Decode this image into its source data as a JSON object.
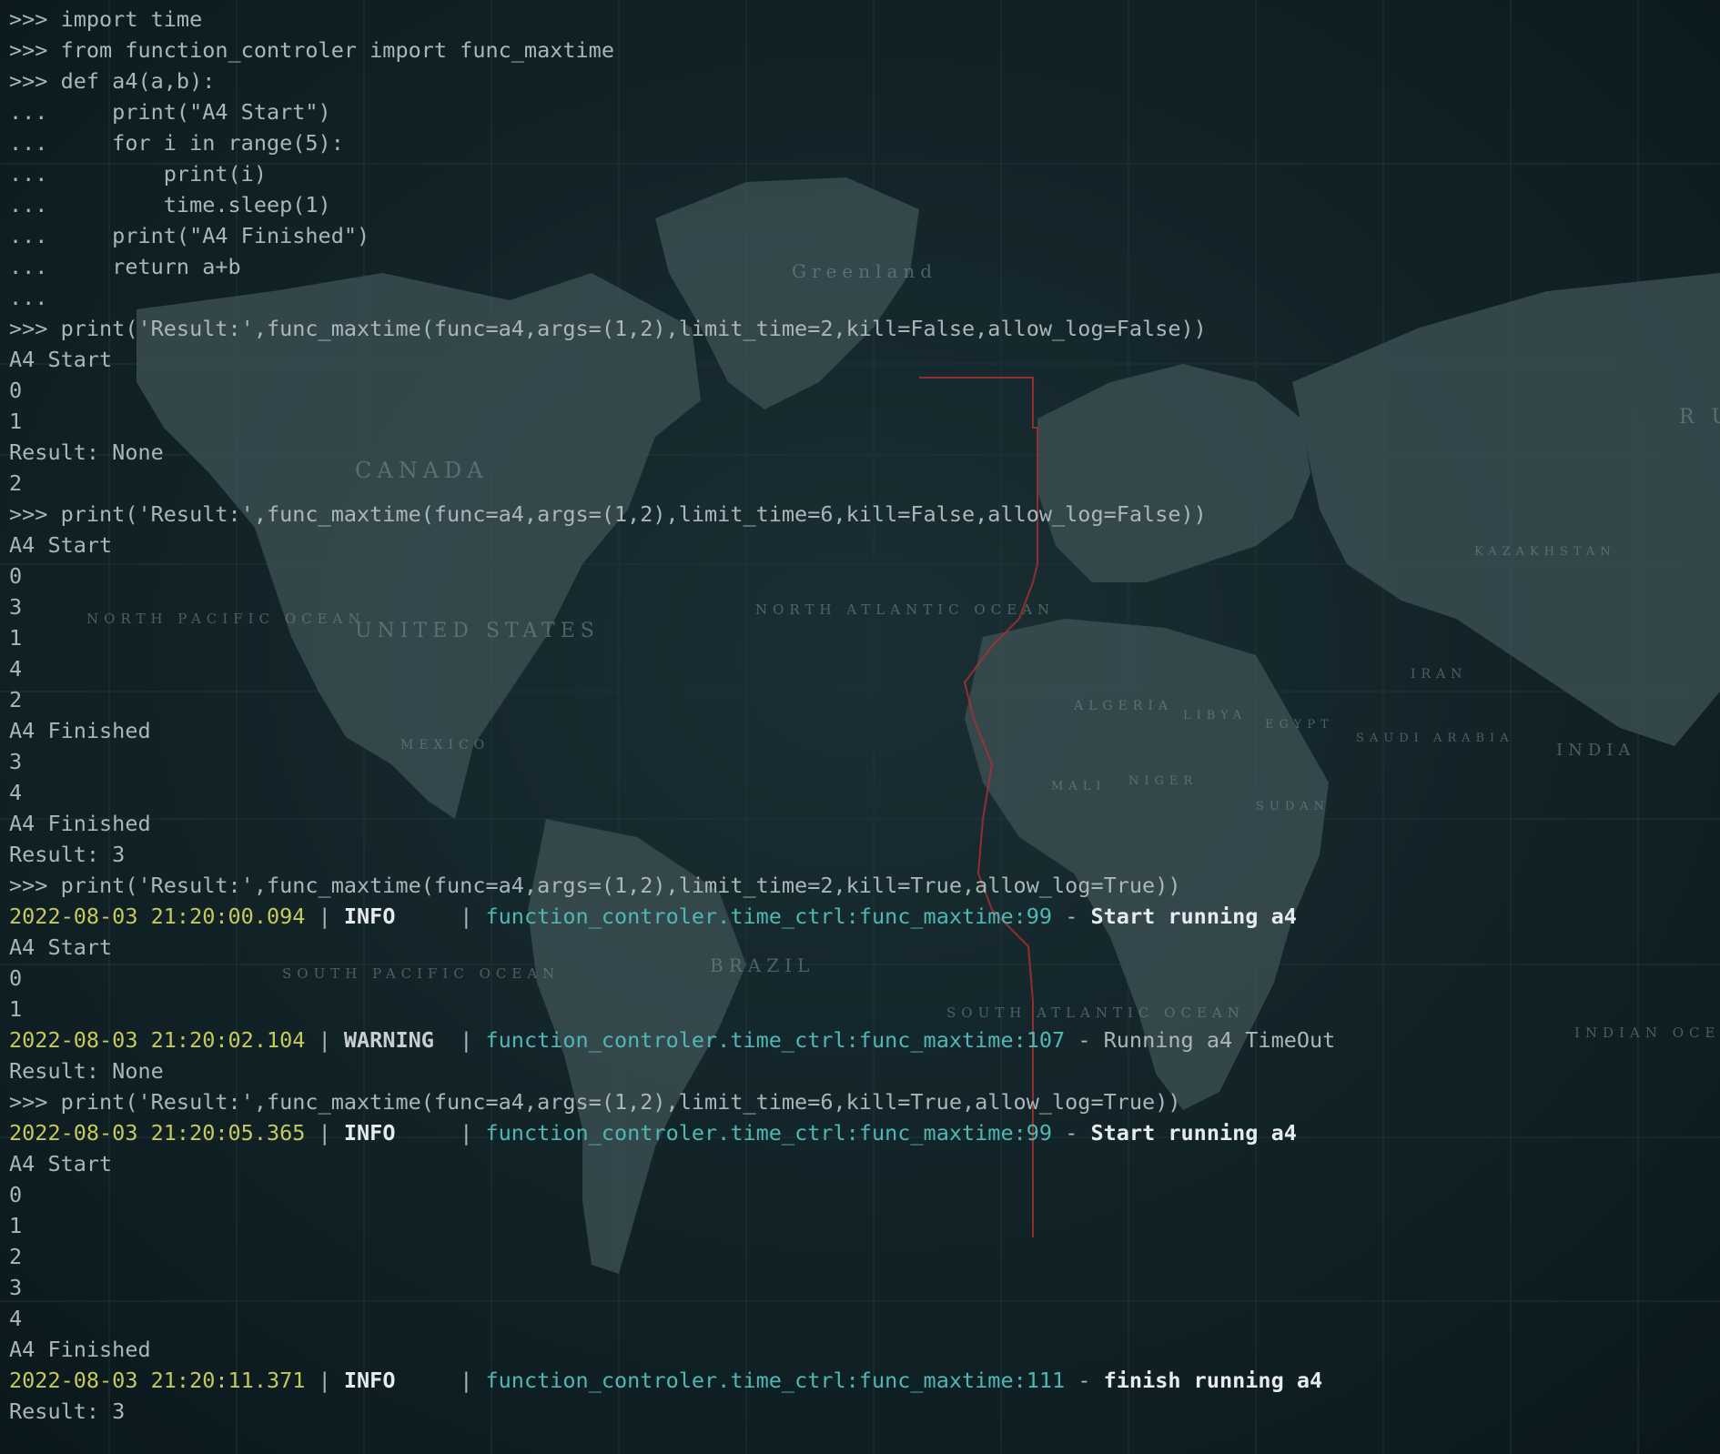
{
  "colors": {
    "background": "#0b1a1e",
    "text": "#a9b6ba",
    "timestamp": "#c7c95a",
    "module": "#4fb8b4",
    "level": "#e6ecee",
    "map_land": "#5c6e72",
    "timezone_line": "#b03030"
  },
  "background_map": {
    "labels": [
      "Greenland",
      "CANADA",
      "UNITED STATES",
      "NORTH PACIFIC OCEAN",
      "NORTH ATLANTIC OCEAN",
      "ALGERIA",
      "LIBYA",
      "EGYPT",
      "SAUDI ARABIA",
      "IRAN",
      "INDIA",
      "KAZAKHSTAN",
      "SUDAN",
      "NIGER",
      "MALI",
      "BRAZIL",
      "MEXICO",
      "SOUTH PACIFIC OCEAN",
      "SOUTH ATLANTIC OCEAN",
      "INDIAN OCEAN",
      "R U"
    ]
  },
  "terminal": {
    "lines": [
      {
        "type": "text",
        "text": ">>> import time"
      },
      {
        "type": "text",
        "text": ">>> from function_controler import func_maxtime"
      },
      {
        "type": "text",
        "text": ">>> def a4(a,b):"
      },
      {
        "type": "text",
        "text": "...     print(\"A4 Start\")"
      },
      {
        "type": "text",
        "text": "...     for i in range(5):"
      },
      {
        "type": "text",
        "text": "...         print(i)"
      },
      {
        "type": "text",
        "text": "...         time.sleep(1)"
      },
      {
        "type": "text",
        "text": "...     print(\"A4 Finished\")"
      },
      {
        "type": "text",
        "text": "...     return a+b"
      },
      {
        "type": "text",
        "text": "..."
      },
      {
        "type": "text",
        "text": ">>> print('Result:',func_maxtime(func=a4,args=(1,2),limit_time=2,kill=False,allow_log=False))"
      },
      {
        "type": "text",
        "text": "A4 Start"
      },
      {
        "type": "text",
        "text": "0"
      },
      {
        "type": "text",
        "text": "1"
      },
      {
        "type": "text",
        "text": "Result: None"
      },
      {
        "type": "text",
        "text": "2"
      },
      {
        "type": "text",
        "text": ">>> print('Result:',func_maxtime(func=a4,args=(1,2),limit_time=6,kill=False,allow_log=False))"
      },
      {
        "type": "text",
        "text": "A4 Start"
      },
      {
        "type": "text",
        "text": "0"
      },
      {
        "type": "text",
        "text": "3"
      },
      {
        "type": "text",
        "text": "1"
      },
      {
        "type": "text",
        "text": "4"
      },
      {
        "type": "text",
        "text": "2"
      },
      {
        "type": "text",
        "text": "A4 Finished"
      },
      {
        "type": "text",
        "text": "3"
      },
      {
        "type": "text",
        "text": "4"
      },
      {
        "type": "text",
        "text": "A4 Finished"
      },
      {
        "type": "text",
        "text": "Result: 3"
      },
      {
        "type": "text",
        "text": ">>> print('Result:',func_maxtime(func=a4,args=(1,2),limit_time=2,kill=True,allow_log=True))"
      },
      {
        "type": "log",
        "timestamp": "2022-08-03 21:20:00.094",
        "level": "INFO",
        "level_padded": "INFO    ",
        "module": "function_controler.time_ctrl:func_maxtime:99",
        "message": "Start running a4"
      },
      {
        "type": "text",
        "text": "A4 Start"
      },
      {
        "type": "text",
        "text": "0"
      },
      {
        "type": "text",
        "text": "1"
      },
      {
        "type": "log",
        "timestamp": "2022-08-03 21:20:02.104",
        "level": "WARNING",
        "level_padded": "WARNING ",
        "module": "function_controler.time_ctrl:func_maxtime:107",
        "message": "Running a4 TimeOut"
      },
      {
        "type": "text",
        "text": "Result: None"
      },
      {
        "type": "text",
        "text": ">>> print('Result:',func_maxtime(func=a4,args=(1,2),limit_time=6,kill=True,allow_log=True))"
      },
      {
        "type": "log",
        "timestamp": "2022-08-03 21:20:05.365",
        "level": "INFO",
        "level_padded": "INFO    ",
        "module": "function_controler.time_ctrl:func_maxtime:99",
        "message": "Start running a4"
      },
      {
        "type": "text",
        "text": "A4 Start"
      },
      {
        "type": "text",
        "text": "0"
      },
      {
        "type": "text",
        "text": "1"
      },
      {
        "type": "text",
        "text": "2"
      },
      {
        "type": "text",
        "text": "3"
      },
      {
        "type": "text",
        "text": "4"
      },
      {
        "type": "text",
        "text": "A4 Finished"
      },
      {
        "type": "log",
        "timestamp": "2022-08-03 21:20:11.371",
        "level": "INFO",
        "level_padded": "INFO    ",
        "module": "function_controler.time_ctrl:func_maxtime:111",
        "message": "finish running a4"
      },
      {
        "type": "text",
        "text": "Result: 3"
      }
    ]
  }
}
